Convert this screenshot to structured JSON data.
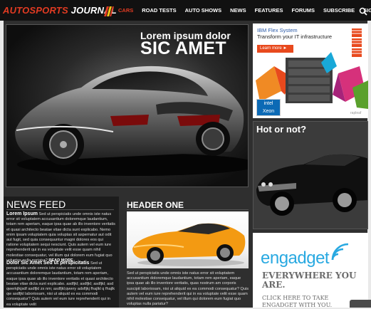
{
  "header": {
    "logo_part1": "AUTOSPORTS",
    "logo_part2": " JOURNAL",
    "nav": [
      "CARS",
      "ROAD TESTS",
      "AUTO SHOWS",
      "NEWS",
      "FEATURES",
      "FORUMS",
      "SUBSCRIBE",
      "SIGN IN"
    ],
    "active_nav": "CARS"
  },
  "hero": {
    "title_line1": "Lorem ipsum dolor",
    "title_line2": "SIC AMET"
  },
  "ads": {
    "ibm": {
      "line1": "IBM Flex System",
      "line2": "Transform your IT infrastructure",
      "button": "Learn more ►",
      "badge_top": "intel",
      "badge_bottom": "Xeon",
      "footer": "rapleaf"
    },
    "engadget": {
      "logo": "engadget",
      "tagline": "EVERYWHERE YOU ARE.",
      "cta": "CLICK HERE TO TAKE ENGADGET WITH YOU."
    }
  },
  "hot_or_not": {
    "title": "Hot or not?"
  },
  "news_feed": {
    "title": "NEWS FEED",
    "items": [
      {
        "heading": "Lorem Ipsum",
        "body": " Sed ut perspiciatis unde omnis iste natus error sit voluptatem accusantium doloremque laudantium, totam rem aperiam, eaque ipsa quae ab illo inventore veritatis et quasi architecto beatae vitae dicta sunt explicabo. Nemo enim ipsam voluptatem quia voluptas sit aspernatur aut odit aut fugit, sed quia consequuntur magni dolores eos qui ratione voluptatem sequi nesciunt. Quis autem vel eum iure reprehenderit qui in ea voluptate velit esse quam nihil molestiae consequatur, vel illum qui dolorem eum fugiat quo voluptas nulla pariatur?",
        "more": " READ MORE"
      },
      {
        "heading": "Dolor Sic Amet Sed ut perspicitatis",
        "body": " Sed ut perspiciatis unde omnis iste natus error sit voluptatem accusantium doloremque laudantium, totam rem aperiam, eaque ipsa quae ab illo inventore veritatis et quasi architecto beatae vitae dicta sunt explicabo. asdfjkl; asdfjkl; asdfjkl; asd qwerkjlkjsdf asdfjkl zx nm; asdfjkl;qwery adsfljkj fhajlkl q fhajlk qw asdfjkl laboriosam, nisi ut aliquid ex ea commodi consequatur? Quis autem vel eum iure reprehenderit qui in ea voluptate velit",
        "more": ""
      }
    ]
  },
  "header_one": {
    "title": "HEADER ONE",
    "body": "Sed ut perspiciatis unde omnis iste natus error sit voluptatem accusantium doloremque laudantium, totam rem aperiam, eaque ipsa quae ab illo inventore veritatis, quas nostrum am corporis suscipit laboriosam, nisi ut aliquid ex ea commodi consequatur? Quis autem vel eum iure reprehenderit qui in ea voluptate velit esse quam nihil molestiae consequatur, vel illum qui dolorem eum fugiat quo voluptas nulla pariatur?"
  },
  "colors": {
    "accent_red": "#e23b22",
    "topbar": "#111111",
    "engadget_blue": "#29a9e1",
    "ibm_orange": "#e8491d"
  }
}
